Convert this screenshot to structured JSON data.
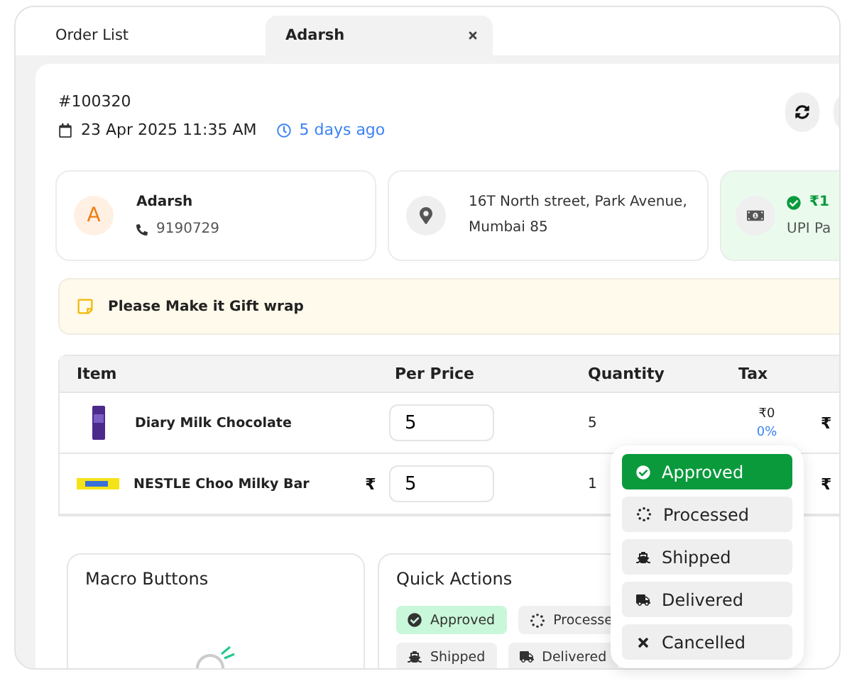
{
  "tabs": [
    {
      "label": "Order List",
      "selected": false,
      "closable": false
    },
    {
      "label": "Adarsh",
      "selected": true,
      "closable": true
    }
  ],
  "order": {
    "number": "#100320",
    "date": "23 Apr 2025 11:35 AM",
    "relative_time": "5 days ago"
  },
  "customer": {
    "initial": "A",
    "name": "Adarsh",
    "phone": "9190729"
  },
  "address": {
    "line_1": "16T North street, Park Avenue,",
    "line_2": "Mumbai 85"
  },
  "payment": {
    "amount": "₹1",
    "method": "UPI Pa",
    "paid": true
  },
  "note": "Please Make it Gift wrap",
  "table": {
    "columns": [
      "Item",
      "Per Price",
      "Quantity",
      "Tax"
    ],
    "rows": [
      {
        "name": "Diary Milk Chocolate",
        "kind": "purple",
        "currency": "",
        "price": "5",
        "quantity": "5",
        "tax_amount": "₹0",
        "tax_rate": "0%",
        "column_5": "₹"
      },
      {
        "name": "NESTLE Choo Milky Bar",
        "kind": "yellow",
        "currency": "₹",
        "price": "5",
        "quantity": "1",
        "tax_amount": "",
        "tax_rate": "",
        "column_5": "₹"
      }
    ]
  },
  "macro_buttons": {
    "title": "Macro Buttons"
  },
  "quick_actions": {
    "title": "Quick Actions",
    "chips": [
      {
        "label": "Approved",
        "kind": "approved",
        "selected": true
      },
      {
        "label": "Processe",
        "kind": "processed",
        "selected": false
      },
      {
        "label": "Shipped",
        "kind": "shipped",
        "selected": false
      },
      {
        "label": "Delivered",
        "kind": "delivered",
        "selected": false
      }
    ]
  },
  "status_menu": [
    {
      "label": "Approved",
      "kind": "approved",
      "selected": true
    },
    {
      "label": "Processed",
      "kind": "processed",
      "selected": false
    },
    {
      "label": "Shipped",
      "kind": "shipped",
      "selected": false
    },
    {
      "label": "Delivered",
      "kind": "delivered",
      "selected": false
    },
    {
      "label": "Cancelled",
      "kind": "cancelled",
      "selected": false
    }
  ]
}
